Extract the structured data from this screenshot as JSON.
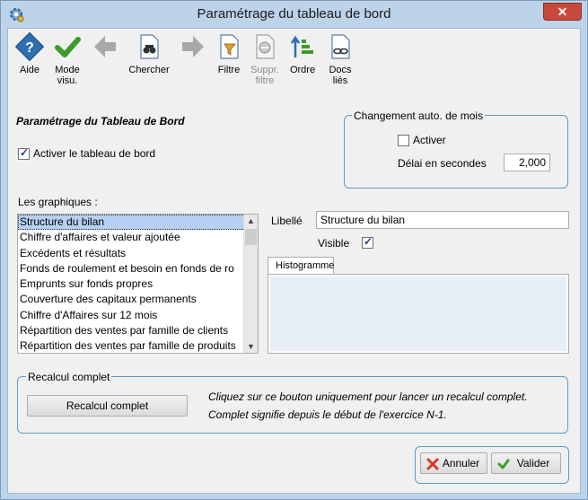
{
  "window": {
    "title": "Paramétrage du tableau de bord",
    "close_label": "✕"
  },
  "toolbar": {
    "aide": "Aide",
    "mode_line1": "Mode",
    "mode_line2": "visu.",
    "chercher": "Chercher",
    "filtre": "Filtre",
    "suppr_line1": "Suppr.",
    "suppr_line2": "filtre",
    "ordre": "Ordre",
    "docs_line1": "Docs",
    "docs_line2": "liés"
  },
  "main": {
    "section_title": "Paramétrage du Tableau de Bord",
    "activer_tableau_label": "Activer le tableau de bord",
    "activer_tableau_checked": true
  },
  "auto_change": {
    "group_title": "Changement auto. de mois",
    "activer_label": "Activer",
    "activer_checked": false,
    "delai_label": "Délai en secondes",
    "delai_value": "2,000"
  },
  "graphs": {
    "label": "Les graphiques :",
    "items": [
      "Structure du bilan",
      "Chiffre d'affaires et valeur ajoutée",
      "Excédents et résultats",
      "Fonds de roulement et besoin en fonds de ro",
      "Emprunts sur fonds propres",
      "Couverture des capitaux permanents",
      "Chiffre d'Affaires sur 12 mois",
      "Répartition des ventes par famille de clients",
      "Répartition des ventes par famille de produits"
    ],
    "selected_index": 0
  },
  "detail": {
    "libelle_label": "Libellé",
    "libelle_value": "Structure du bilan",
    "visible_label": "Visible",
    "visible_checked": true,
    "tab_label": "Histogramme"
  },
  "recalcul": {
    "group_title": "Recalcul complet",
    "button_label": "Recalcul complet",
    "help_line1": "Cliquez sur ce bouton uniquement pour lancer un recalcul complet.",
    "help_line2": "Complet signifie depuis le début de l'exercice N-1."
  },
  "footer": {
    "annuler": "Annuler",
    "valider": "Valider"
  },
  "colors": {
    "accent": "#5f9cc0",
    "selection": "#b5d0f2",
    "titlebar": "#bcd3ea",
    "close": "#c7493c"
  }
}
